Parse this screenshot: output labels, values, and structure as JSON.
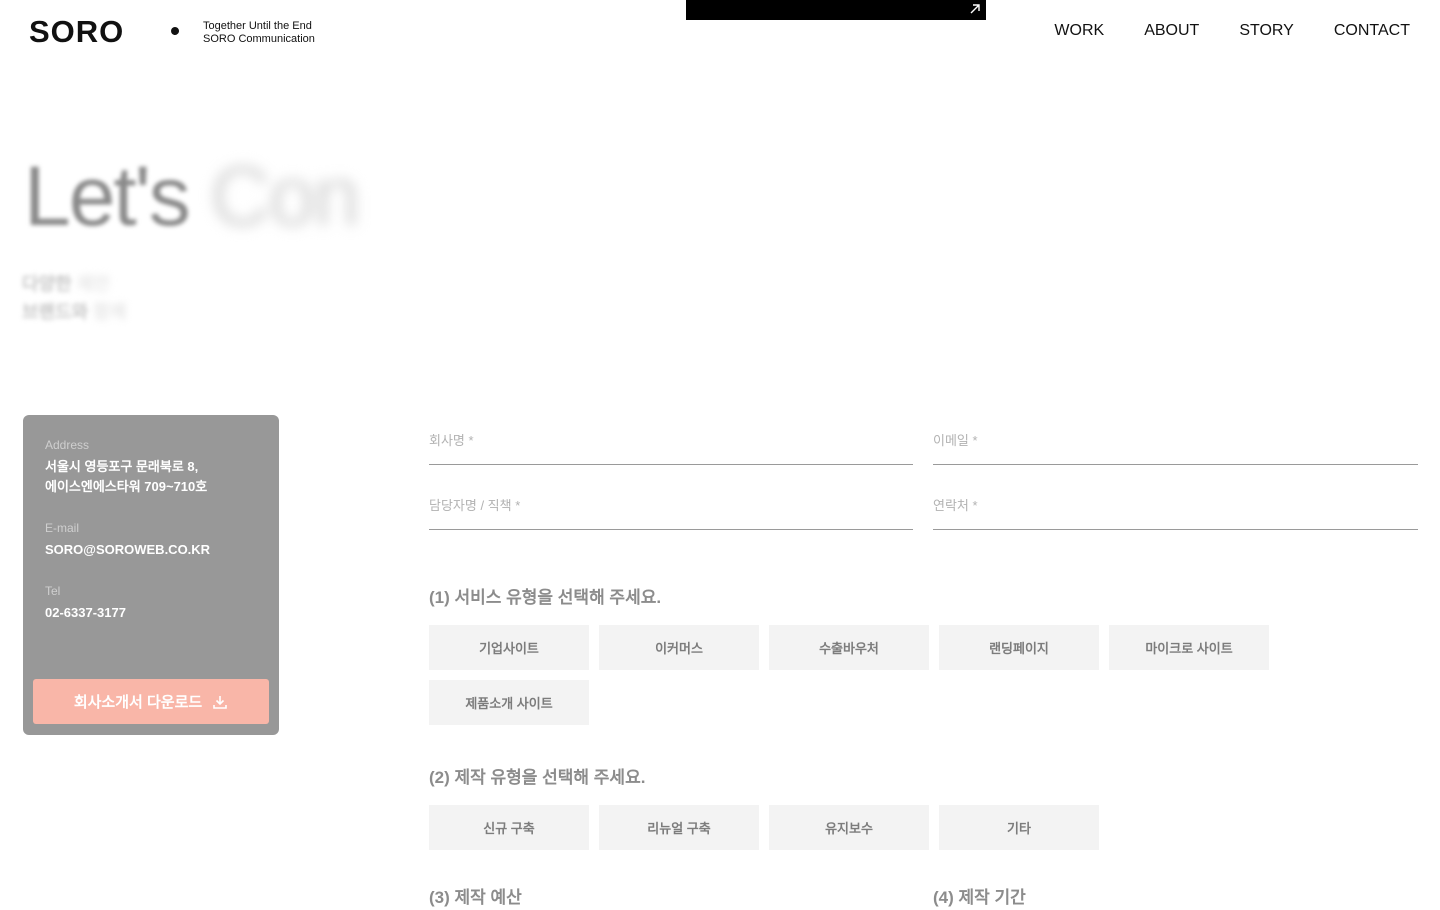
{
  "header": {
    "logo": "SORO",
    "tagline_line1": "Together Until the End",
    "tagline_line2": "SORO Communication",
    "nav": [
      "WORK",
      "ABOUT",
      "STORY",
      "CONTACT"
    ]
  },
  "hero": {
    "title_visible": "Let's ",
    "title_faded": "Con",
    "sub_line1_visible": "다양한 ",
    "sub_line1_faded": "제안",
    "sub_line2_visible": "브랜드와 ",
    "sub_line2_faded": "함께"
  },
  "contact_card": {
    "address_label": "Address",
    "address_line1": "서울시 영등포구 문래북로 8,",
    "address_line2": "에이스엔에스타워 709~710호",
    "email_label": "E-mail",
    "email_value": "SORO@SOROWEB.CO.KR",
    "tel_label": "Tel",
    "tel_value": "02-6337-3177",
    "download_label": "회사소개서 다운로드",
    "download_icon": "download-icon"
  },
  "form": {
    "company_placeholder": "회사명 *",
    "email_placeholder": "이메일 *",
    "contact_person_placeholder": "담당자명 / 직책 *",
    "phone_placeholder": "연락처 *"
  },
  "service_type": {
    "title": "(1) 서비스 유형을 선택해 주세요.",
    "options": [
      "기업사이트",
      "이커머스",
      "수출바우처",
      "랜딩페이지",
      "마이크로 사이트",
      "제품소개 사이트"
    ]
  },
  "production_type": {
    "title": "(2) 제작 유형을 선택해 주세요.",
    "options": [
      "신규 구축",
      "리뉴얼 구축",
      "유지보수",
      "기타"
    ]
  },
  "partial_sections": {
    "budget_title": "(3) 제작 예산",
    "period_title": "(4) 제작 기간"
  },
  "colors": {
    "card_bg": "#989898",
    "download_button": "#f9b6a8",
    "option_bg": "#f3f3f3"
  }
}
